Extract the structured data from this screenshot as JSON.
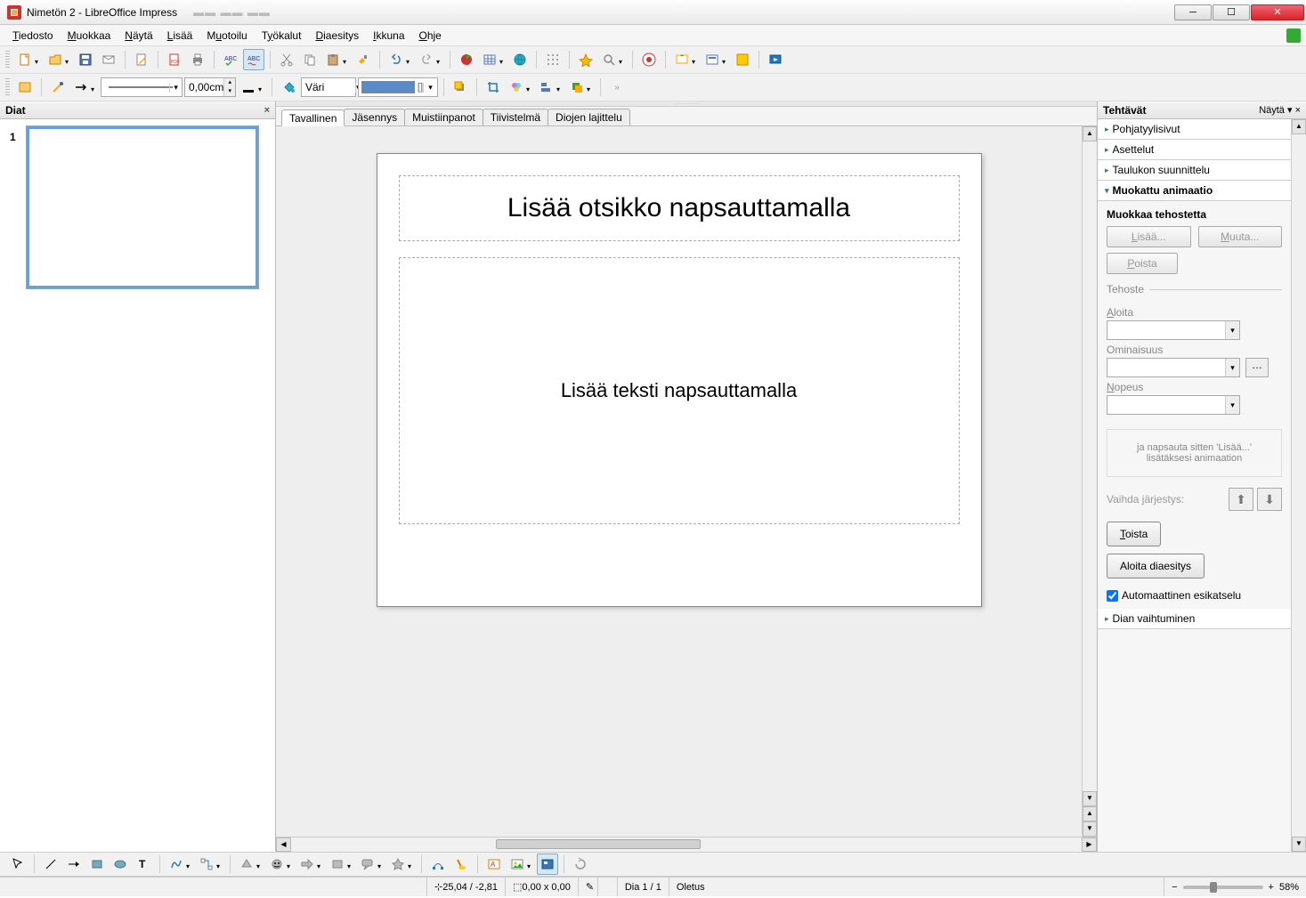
{
  "title": "Nimetön 2 - LibreOffice Impress",
  "menu": [
    "Tiedosto",
    "Muokkaa",
    "Näytä",
    "Lisää",
    "Muotoilu",
    "Työkalut",
    "Diaesitys",
    "Ikkuna",
    "Ohje"
  ],
  "menu_underline": [
    0,
    0,
    0,
    0,
    1,
    1,
    0,
    0,
    0
  ],
  "toolbar2": {
    "line_width": "0,00cm",
    "fill_label": "Väri",
    "fill_bracket": "[]"
  },
  "slides_panel": {
    "title": "Diat",
    "slides": [
      {
        "num": "1"
      }
    ]
  },
  "view_tabs": [
    "Tavallinen",
    "Jäsennys",
    "Muistiinpanot",
    "Tiivistelmä",
    "Diojen lajittelu"
  ],
  "active_view_tab": 0,
  "slide": {
    "title_placeholder": "Lisää otsikko napsauttamalla",
    "body_placeholder": "Lisää teksti napsauttamalla"
  },
  "tasks_panel": {
    "title": "Tehtävät",
    "show_label": "Näytä",
    "sections": [
      "Pohjatyylisivut",
      "Asettelut",
      "Taulukon suunnittelu",
      "Muokattu animaatio",
      "Dian vaihtuminen"
    ],
    "expanded_index": 3,
    "anim": {
      "edit_title": "Muokkaa tehostetta",
      "btn_add": "Lisää...",
      "btn_change": "Muuta...",
      "btn_remove": "Poista",
      "effect_legend": "Tehoste",
      "start_label": "Aloita",
      "property_label": "Ominaisuus",
      "speed_label": "Nopeus",
      "hint": "ja napsauta sitten 'Lisää...' lisätäksesi animaation",
      "order_label": "Vaihda järjestys:",
      "btn_play": "Toista",
      "btn_show": "Aloita diaesitys",
      "auto_preview": "Automaattinen esikatselu"
    }
  },
  "statusbar": {
    "coords": "25,04 / -2,81",
    "size": "0,00 x 0,00",
    "slide_info": "Dia 1 / 1",
    "layout": "Oletus",
    "zoom": "58%"
  }
}
